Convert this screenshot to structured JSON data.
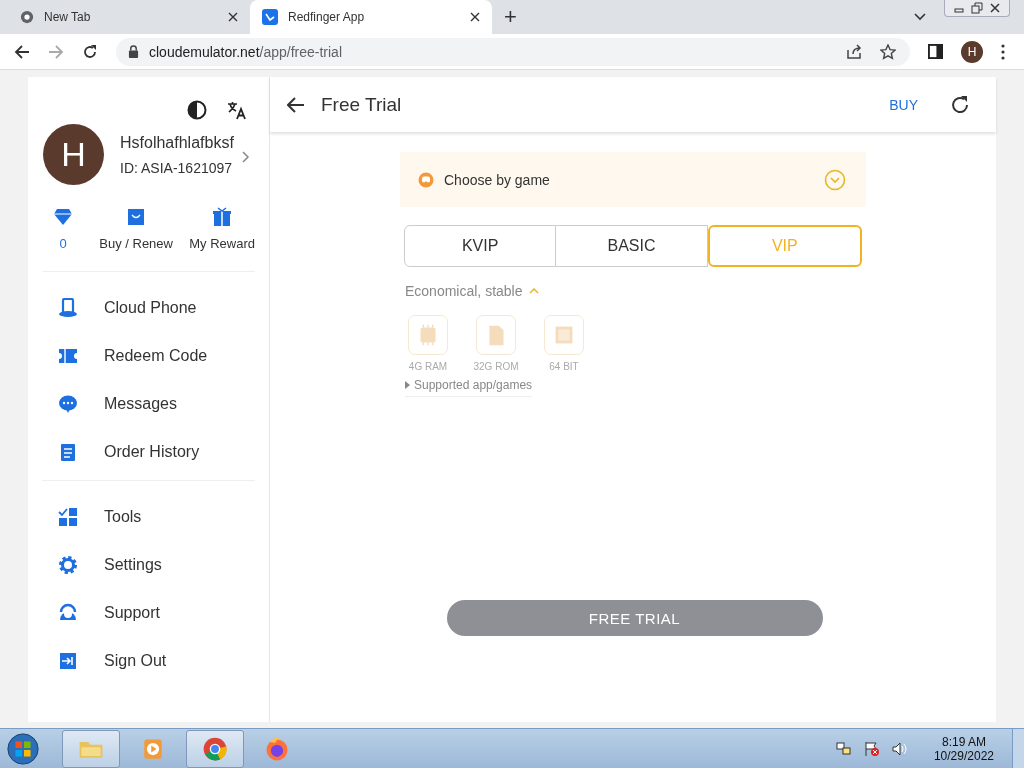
{
  "browser": {
    "tabs": [
      {
        "title": "New Tab",
        "selected": false
      },
      {
        "title": "Redfinger App",
        "selected": true
      }
    ],
    "new_tab": "+",
    "url_host": "cloudemulator.net",
    "url_path": "/app/free-trial",
    "profile_initial": "H"
  },
  "sidebar": {
    "avatar_initial": "H",
    "user_name": "Hsfolhafhlafbksf",
    "user_id": "ID: ASIA-1621097",
    "stats": [
      {
        "label": "0"
      },
      {
        "label": "Buy / Renew"
      },
      {
        "label": "My Reward"
      }
    ],
    "menu_groups": [
      [
        {
          "label": "Cloud Phone"
        },
        {
          "label": "Redeem Code"
        },
        {
          "label": "Messages"
        },
        {
          "label": "Order History"
        }
      ],
      [
        {
          "label": "Tools"
        },
        {
          "label": "Settings"
        },
        {
          "label": "Support"
        },
        {
          "label": "Sign Out"
        }
      ]
    ]
  },
  "header": {
    "title": "Free Trial",
    "action": "BUY"
  },
  "game_picker": {
    "label": "Choose by game"
  },
  "plan_tabs": [
    {
      "label": "KVIP",
      "selected": false
    },
    {
      "label": "BASIC",
      "selected": false
    },
    {
      "label": "VIP",
      "selected": true
    }
  ],
  "plan": {
    "summary": "Economical, stable",
    "expanded": true,
    "specs": [
      {
        "label": "4G RAM"
      },
      {
        "label": "32G ROM"
      },
      {
        "label": "64 BIT"
      }
    ],
    "supported_link": "Supported app/games"
  },
  "primary_button": "FREE TRIAL",
  "taskbar": {
    "time": "8:19 AM",
    "date": "10/29/2022"
  }
}
